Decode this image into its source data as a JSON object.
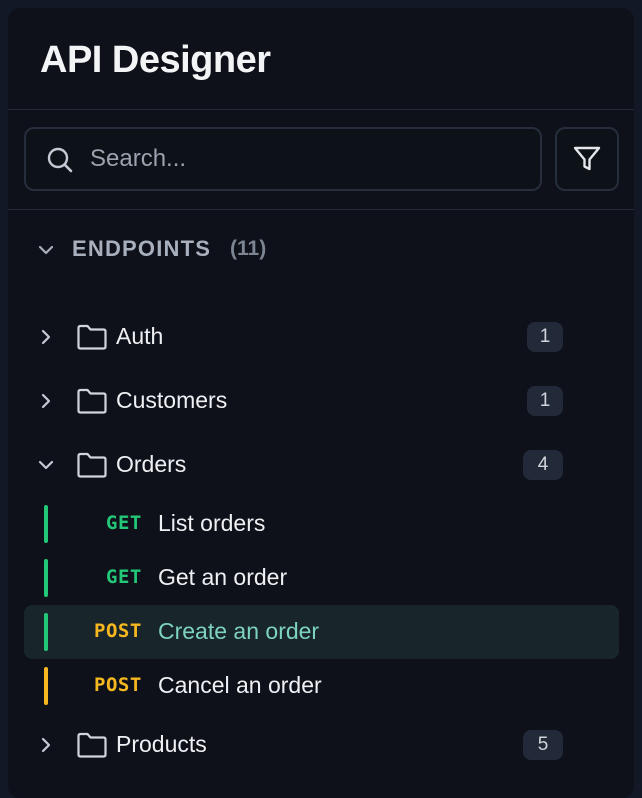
{
  "app": {
    "title": "API Designer"
  },
  "search": {
    "placeholder": "Search..."
  },
  "section": {
    "title": "ENDPOINTS",
    "count": "(11)"
  },
  "colors": {
    "get": "#22c777",
    "post": "#f6b720",
    "active_text": "#7dd3c0",
    "active_bg": "#18252a"
  },
  "tree": {
    "auth": {
      "label": "Auth",
      "count": "1"
    },
    "customers": {
      "label": "Customers",
      "count": "1"
    },
    "orders": {
      "label": "Orders",
      "count": "4",
      "endpoints": [
        {
          "method": "GET",
          "label": "List orders"
        },
        {
          "method": "GET",
          "label": "Get an order"
        },
        {
          "method": "POST",
          "label": "Create an order",
          "active": true
        },
        {
          "method": "POST",
          "label": "Cancel an order"
        }
      ]
    },
    "products": {
      "label": "Products",
      "count": "5"
    }
  }
}
